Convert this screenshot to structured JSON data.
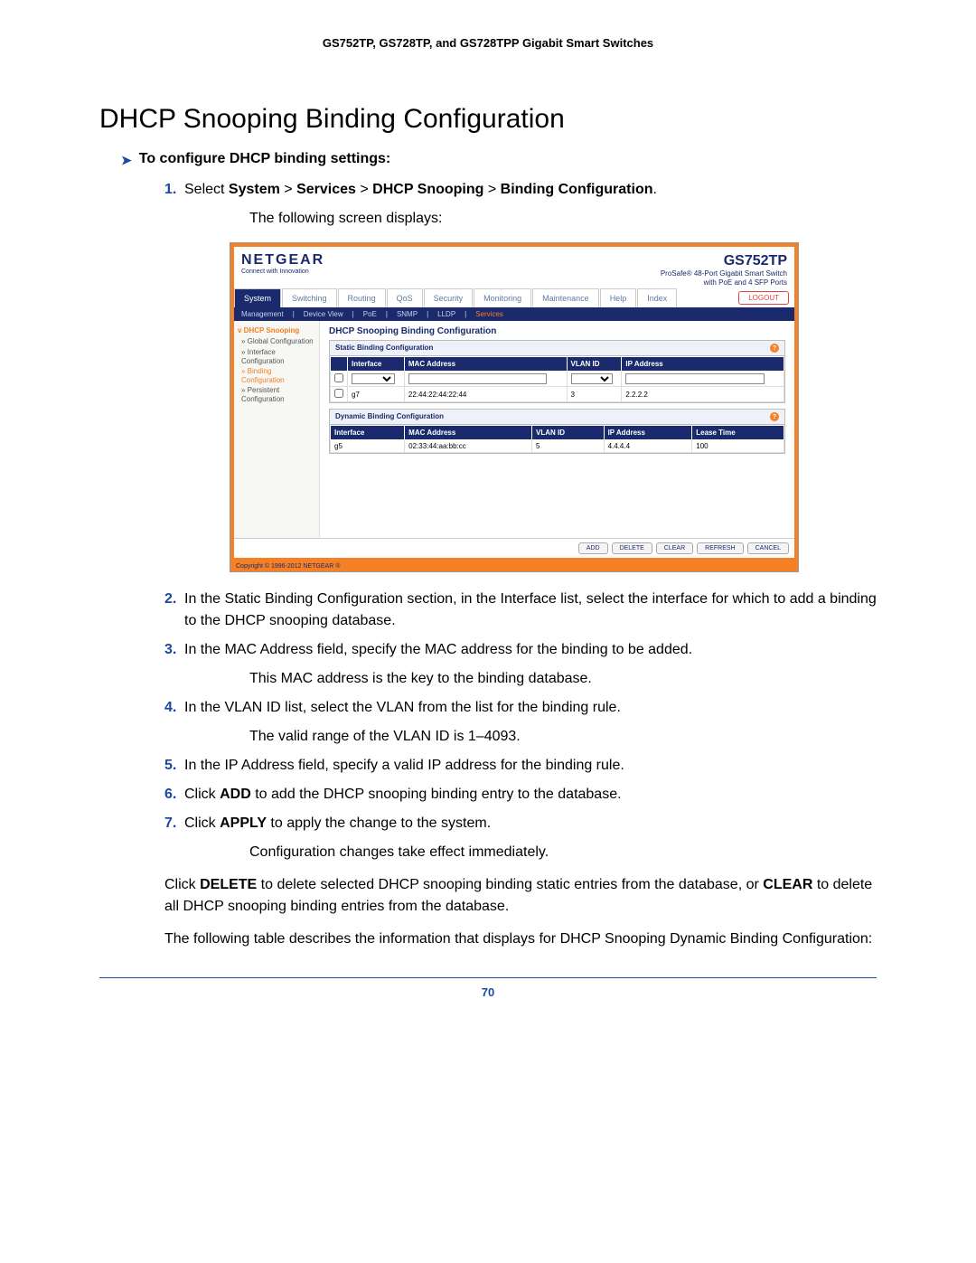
{
  "doc_header": "GS752TP, GS728TP, and GS728TPP Gigabit Smart Switches",
  "section_title": "DHCP Snooping Binding Configuration",
  "procedure_title": "To configure DHCP binding settings:",
  "steps": {
    "s1_a": "Select ",
    "s1_b": "System",
    "s1_c": "Services",
    "s1_d": "DHCP Snooping",
    "s1_e": "Binding Configuration",
    "s1_after": "The following screen displays:",
    "s2": "In the Static Binding Configuration section, in the Interface list, select the interface for which to add a binding to the DHCP snooping database.",
    "s3": "In the MAC Address field, specify the MAC address for the binding to be added.",
    "s3_after": "This MAC address is the key to the binding database.",
    "s4": "In the VLAN ID list, select the VLAN from the list for the binding rule.",
    "s4_after": "The valid range of the VLAN ID is 1–4093.",
    "s5": "In the IP Address field, specify a valid IP address for the binding rule.",
    "s6_a": "Click ",
    "s6_b": "ADD",
    "s6_c": " to add the DHCP snooping binding entry to the database.",
    "s7_a": "Click ",
    "s7_b": "APPLY",
    "s7_c": " to apply the change to the system.",
    "s7_after": "Configuration changes take effect immediately."
  },
  "post": {
    "p_del_a": "Click ",
    "p_del_b": "DELETE",
    "p_del_c": " to delete selected DHCP snooping binding static entries from the database, or ",
    "p_del_d": "CLEAR",
    "p_del_e": " to delete all DHCP snooping binding entries from the database.",
    "p_tbl": "The following table describes the information that displays for DHCP Snooping Dynamic Binding Configuration:"
  },
  "screenshot": {
    "logo": "NETGEAR",
    "logo_tag": "Connect with Innovation",
    "model": "GS752TP",
    "model_line1": "ProSafe® 48-Port Gigabit Smart Switch",
    "model_line2": "with PoE and 4 SFP Ports",
    "tabs": [
      "System",
      "Switching",
      "Routing",
      "QoS",
      "Security",
      "Monitoring",
      "Maintenance",
      "Help",
      "Index"
    ],
    "logout": "LOGOUT",
    "subtabs": [
      "Management",
      "Device View",
      "PoE",
      "SNMP",
      "LLDP",
      "Services"
    ],
    "side_group": "DHCP Snooping",
    "side_items": [
      "Global Configuration",
      "Interface Configuration",
      "Binding Configuration",
      "Persistent Configuration"
    ],
    "panel_title": "DHCP Snooping Binding Configuration",
    "static_title": "Static Binding Configuration",
    "static_cols": [
      "Interface",
      "MAC Address",
      "VLAN ID",
      "IP Address"
    ],
    "static_row": {
      "interface": "g7",
      "mac": "22:44:22:44:22:44",
      "vlan": "3",
      "ip": "2.2.2.2"
    },
    "dynamic_title": "Dynamic Binding Configuration",
    "dynamic_cols": [
      "Interface",
      "MAC Address",
      "VLAN ID",
      "IP Address",
      "Lease Time"
    ],
    "dynamic_row": {
      "interface": "g5",
      "mac": "02:33:44:aa:bb:cc",
      "vlan": "5",
      "ip": "4.4.4.4",
      "lease": "100"
    },
    "buttons": [
      "ADD",
      "DELETE",
      "CLEAR",
      "REFRESH",
      "CANCEL"
    ],
    "copyright": "Copyright © 1996-2012 NETGEAR ®"
  },
  "page_number": "70"
}
